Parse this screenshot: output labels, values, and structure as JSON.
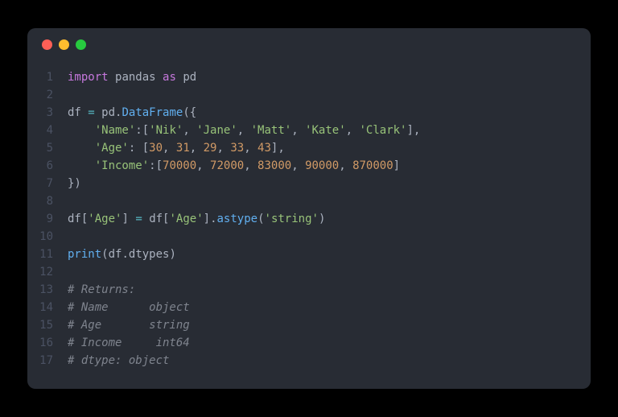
{
  "titlebar": {
    "dots": [
      "red",
      "yellow",
      "green"
    ]
  },
  "code": {
    "lines": [
      {
        "n": 1,
        "tokens": [
          {
            "c": "kw",
            "t": "import"
          },
          {
            "c": "punct",
            "t": " "
          },
          {
            "c": "mod",
            "t": "pandas"
          },
          {
            "c": "punct",
            "t": " "
          },
          {
            "c": "kw",
            "t": "as"
          },
          {
            "c": "punct",
            "t": " "
          },
          {
            "c": "mod",
            "t": "pd"
          }
        ]
      },
      {
        "n": 2,
        "tokens": []
      },
      {
        "n": 3,
        "tokens": [
          {
            "c": "mod",
            "t": "df "
          },
          {
            "c": "op",
            "t": "="
          },
          {
            "c": "mod",
            "t": " pd"
          },
          {
            "c": "punct",
            "t": "."
          },
          {
            "c": "fn",
            "t": "DataFrame"
          },
          {
            "c": "punct",
            "t": "({"
          }
        ]
      },
      {
        "n": 4,
        "tokens": [
          {
            "c": "punct",
            "t": "    "
          },
          {
            "c": "str",
            "t": "'Name'"
          },
          {
            "c": "punct",
            "t": ":["
          },
          {
            "c": "str",
            "t": "'Nik'"
          },
          {
            "c": "punct",
            "t": ", "
          },
          {
            "c": "str",
            "t": "'Jane'"
          },
          {
            "c": "punct",
            "t": ", "
          },
          {
            "c": "str",
            "t": "'Matt'"
          },
          {
            "c": "punct",
            "t": ", "
          },
          {
            "c": "str",
            "t": "'Kate'"
          },
          {
            "c": "punct",
            "t": ", "
          },
          {
            "c": "str",
            "t": "'Clark'"
          },
          {
            "c": "punct",
            "t": "],"
          }
        ]
      },
      {
        "n": 5,
        "tokens": [
          {
            "c": "punct",
            "t": "    "
          },
          {
            "c": "str",
            "t": "'Age'"
          },
          {
            "c": "punct",
            "t": ": ["
          },
          {
            "c": "num",
            "t": "30"
          },
          {
            "c": "punct",
            "t": ", "
          },
          {
            "c": "num",
            "t": "31"
          },
          {
            "c": "punct",
            "t": ", "
          },
          {
            "c": "num",
            "t": "29"
          },
          {
            "c": "punct",
            "t": ", "
          },
          {
            "c": "num",
            "t": "33"
          },
          {
            "c": "punct",
            "t": ", "
          },
          {
            "c": "num",
            "t": "43"
          },
          {
            "c": "punct",
            "t": "],"
          }
        ]
      },
      {
        "n": 6,
        "tokens": [
          {
            "c": "punct",
            "t": "    "
          },
          {
            "c": "str",
            "t": "'Income'"
          },
          {
            "c": "punct",
            "t": ":["
          },
          {
            "c": "num",
            "t": "70000"
          },
          {
            "c": "punct",
            "t": ", "
          },
          {
            "c": "num",
            "t": "72000"
          },
          {
            "c": "punct",
            "t": ", "
          },
          {
            "c": "num",
            "t": "83000"
          },
          {
            "c": "punct",
            "t": ", "
          },
          {
            "c": "num",
            "t": "90000"
          },
          {
            "c": "punct",
            "t": ", "
          },
          {
            "c": "num",
            "t": "870000"
          },
          {
            "c": "punct",
            "t": "]"
          }
        ]
      },
      {
        "n": 7,
        "tokens": [
          {
            "c": "punct",
            "t": "})"
          }
        ]
      },
      {
        "n": 8,
        "tokens": []
      },
      {
        "n": 9,
        "tokens": [
          {
            "c": "mod",
            "t": "df"
          },
          {
            "c": "punct",
            "t": "["
          },
          {
            "c": "str",
            "t": "'Age'"
          },
          {
            "c": "punct",
            "t": "] "
          },
          {
            "c": "op",
            "t": "="
          },
          {
            "c": "punct",
            "t": " "
          },
          {
            "c": "mod",
            "t": "df"
          },
          {
            "c": "punct",
            "t": "["
          },
          {
            "c": "str",
            "t": "'Age'"
          },
          {
            "c": "punct",
            "t": "]."
          },
          {
            "c": "fn",
            "t": "astype"
          },
          {
            "c": "punct",
            "t": "("
          },
          {
            "c": "str",
            "t": "'string'"
          },
          {
            "c": "punct",
            "t": ")"
          }
        ]
      },
      {
        "n": 10,
        "tokens": []
      },
      {
        "n": 11,
        "tokens": [
          {
            "c": "fn",
            "t": "print"
          },
          {
            "c": "punct",
            "t": "("
          },
          {
            "c": "mod",
            "t": "df"
          },
          {
            "c": "punct",
            "t": "."
          },
          {
            "c": "mod",
            "t": "dtypes"
          },
          {
            "c": "punct",
            "t": ")"
          }
        ]
      },
      {
        "n": 12,
        "tokens": []
      },
      {
        "n": 13,
        "tokens": [
          {
            "c": "comment",
            "t": "# Returns:"
          }
        ]
      },
      {
        "n": 14,
        "tokens": [
          {
            "c": "comment",
            "t": "# Name      object"
          }
        ]
      },
      {
        "n": 15,
        "tokens": [
          {
            "c": "comment",
            "t": "# Age       string"
          }
        ]
      },
      {
        "n": 16,
        "tokens": [
          {
            "c": "comment",
            "t": "# Income     int64"
          }
        ]
      },
      {
        "n": 17,
        "tokens": [
          {
            "c": "comment",
            "t": "# dtype: object"
          }
        ]
      }
    ]
  }
}
